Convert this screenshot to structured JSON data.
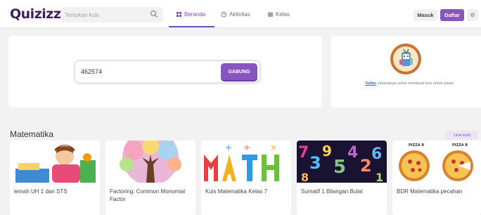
{
  "header": {
    "logo": "Quizizz",
    "search_placeholder": "Temukan kuis",
    "nav": [
      {
        "label": "Beranda",
        "icon": "home-icon",
        "active": true
      },
      {
        "label": "Aktivitas",
        "icon": "clock-icon",
        "active": false
      },
      {
        "label": "Kelas",
        "icon": "class-icon",
        "active": false
      }
    ],
    "login_label": "Masuk",
    "signup_label": "Daftar"
  },
  "join": {
    "code_value": "462574",
    "join_label": "GABUNG"
  },
  "promo": {
    "link_label": "Daftar",
    "text": "selamanya untuk membuat kuis untuk siswa"
  },
  "section": {
    "title": "Matematika",
    "see_more_label": "Lihat lebih"
  },
  "quizzes": [
    {
      "title": "lemah UH 1 dan STS"
    },
    {
      "title": "Factoring: Common Monomial Factor"
    },
    {
      "title": "Kuis Matematika Kelas 7"
    },
    {
      "title": "Sumatif 1 Bilangan Bulat"
    },
    {
      "title": "BDR Matematika pecahan"
    }
  ],
  "pizza_labels": [
    "PIZZA R",
    "PIZZA R"
  ],
  "colors": {
    "accent": "#8854c0",
    "logo": "#3b1f5c",
    "link": "#3b6fd8"
  }
}
